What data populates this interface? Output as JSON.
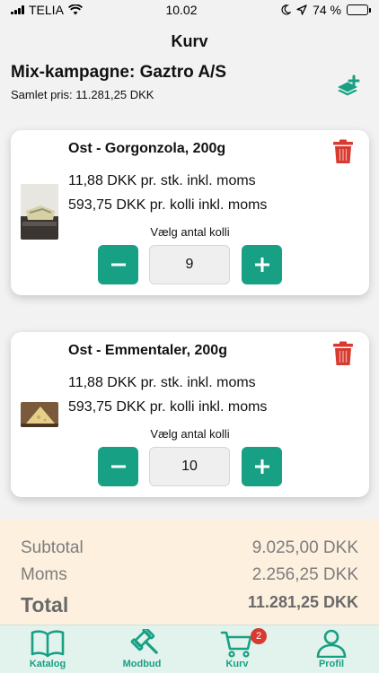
{
  "status_bar": {
    "carrier": "TELIA",
    "time": "10.02",
    "battery": "74 %",
    "battery_level": 0.74
  },
  "header": {
    "title": "Kurv"
  },
  "campaign": {
    "title": "Mix-kampagne: Gaztro A/S",
    "total": "Samlet pris: 11.281,25 DKK",
    "action_icon": "layers-plus-icon"
  },
  "items": [
    {
      "name": "Ost - Gorgonzola, 200g",
      "price_unit": "11,88 DKK pr. stk. inkl. moms",
      "price_colli": "593,75 DKK pr. kolli inkl. moms",
      "qty_label": "Vælg antal kolli",
      "quantity": "9"
    },
    {
      "name": "Ost - Emmentaler, 200g",
      "price_unit": "11,88 DKK pr. stk. inkl. moms",
      "price_colli": "593,75 DKK pr. kolli inkl. moms",
      "qty_label": "Vælg antal kolli",
      "quantity": "10"
    }
  ],
  "summary": {
    "subtotal_label": "Subtotal",
    "subtotal_value": "9.025,00 DKK",
    "moms_label": "Moms",
    "moms_value": "2.256,25 DKK",
    "total_label": "Total",
    "total_value": "11.281,25 DKK"
  },
  "tabbar": {
    "tabs": [
      {
        "label": "Katalog",
        "icon": "book-icon"
      },
      {
        "label": "Modbud",
        "icon": "gavel-icon"
      },
      {
        "label": "Kurv",
        "icon": "cart-icon",
        "badge": "2"
      },
      {
        "label": "Profil",
        "icon": "user-icon"
      }
    ]
  },
  "colors": {
    "accent": "#17a084",
    "danger": "#d93a2f",
    "summary_bg": "#fdf0df",
    "tabbar_bg": "#e2f2ec"
  }
}
